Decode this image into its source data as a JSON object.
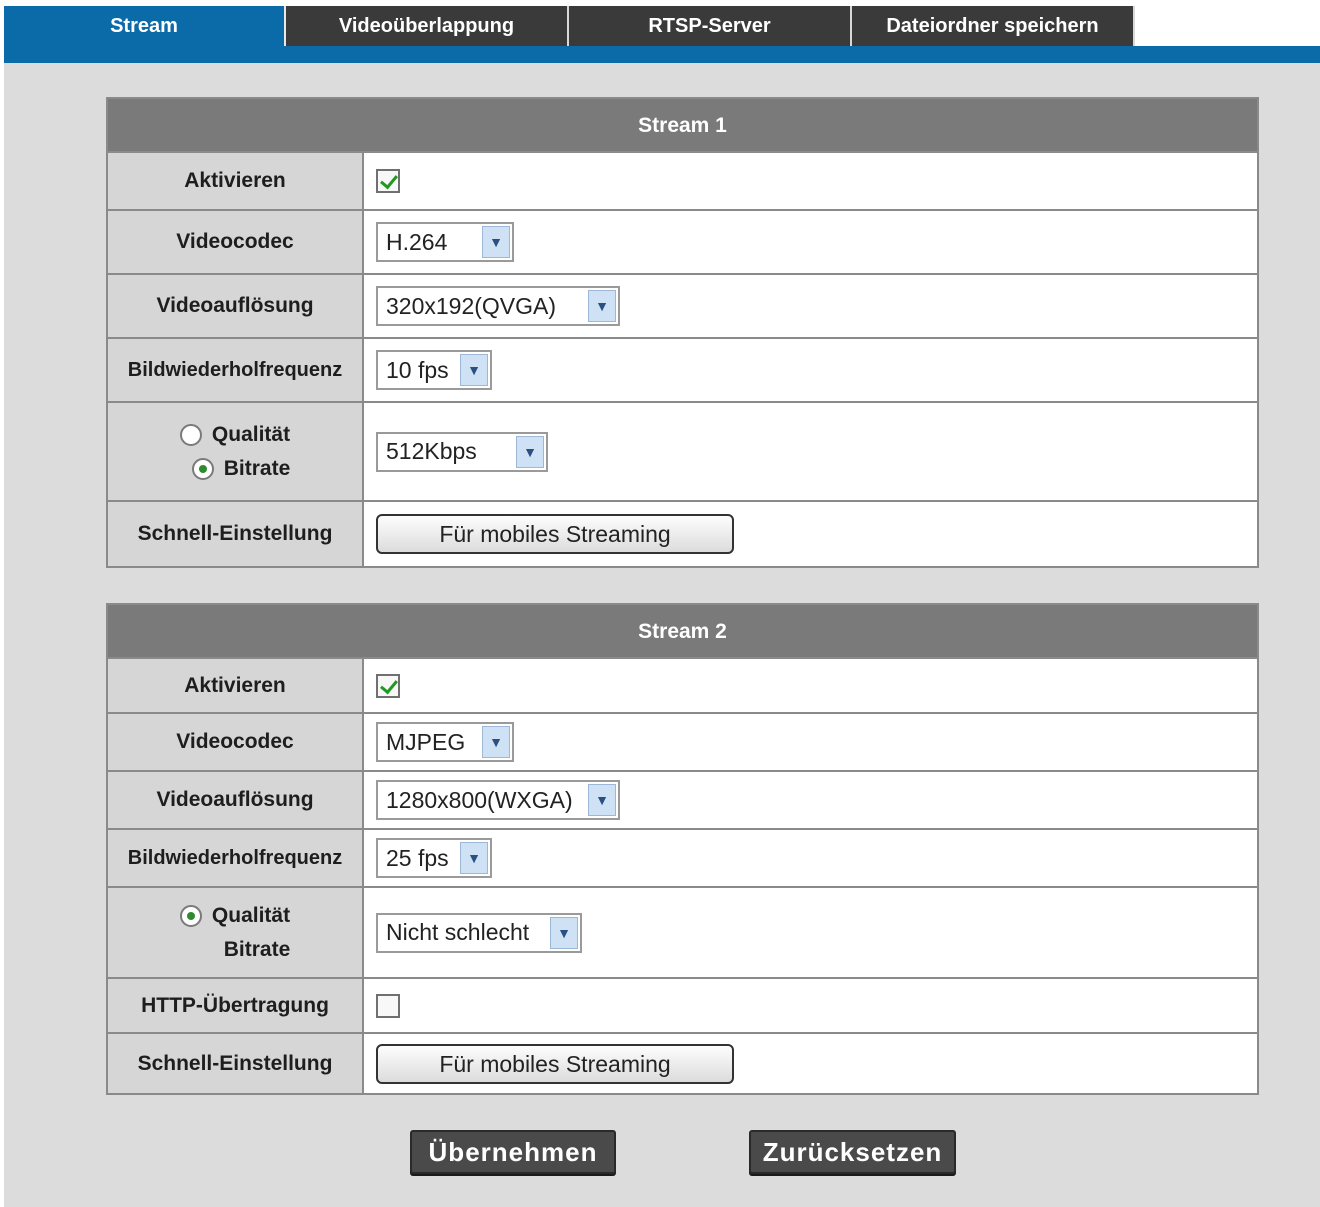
{
  "tabs": [
    {
      "label": "Stream",
      "active": true
    },
    {
      "label": "Videoüberlappung",
      "active": false
    },
    {
      "label": "RTSP-Server",
      "active": false
    },
    {
      "label": "Dateiordner speichern",
      "active": false
    }
  ],
  "stream1": {
    "title": "Stream 1",
    "aktivieren_label": "Aktivieren",
    "aktivieren_checked": true,
    "videocodec_label": "Videocodec",
    "videocodec_value": "H.264",
    "aufloesung_label": "Videoauflösung",
    "aufloesung_value": "320x192(QVGA)",
    "fps_label": "Bildwiederholfrequenz",
    "fps_value": "10 fps",
    "qualitaet_label": "Qualität",
    "bitrate_label": "Bitrate",
    "rate_mode": "Bitrate",
    "rate_value": "512Kbps",
    "schnell_label": "Schnell-Einstellung",
    "mobile_button": "Für mobiles Streaming"
  },
  "stream2": {
    "title": "Stream 2",
    "aktivieren_label": "Aktivieren",
    "aktivieren_checked": true,
    "videocodec_label": "Videocodec",
    "videocodec_value": "MJPEG",
    "aufloesung_label": "Videoauflösung",
    "aufloesung_value": "1280x800(WXGA)",
    "fps_label": "Bildwiederholfrequenz",
    "fps_value": "25 fps",
    "qualitaet_label": "Qualität",
    "bitrate_label": "Bitrate",
    "rate_mode": "Qualität",
    "rate_value": "Nicht schlecht",
    "http_label": "HTTP-Übertragung",
    "http_checked": false,
    "schnell_label": "Schnell-Einstellung",
    "mobile_button": "Für mobiles Streaming"
  },
  "actions": {
    "apply": "Übernehmen",
    "reset": "Zurücksetzen"
  },
  "colors": {
    "accent": "#0b6aa8",
    "tab_inactive": "#3a3a3a",
    "header": "#7a7a7a",
    "background": "#dcdcdc"
  }
}
